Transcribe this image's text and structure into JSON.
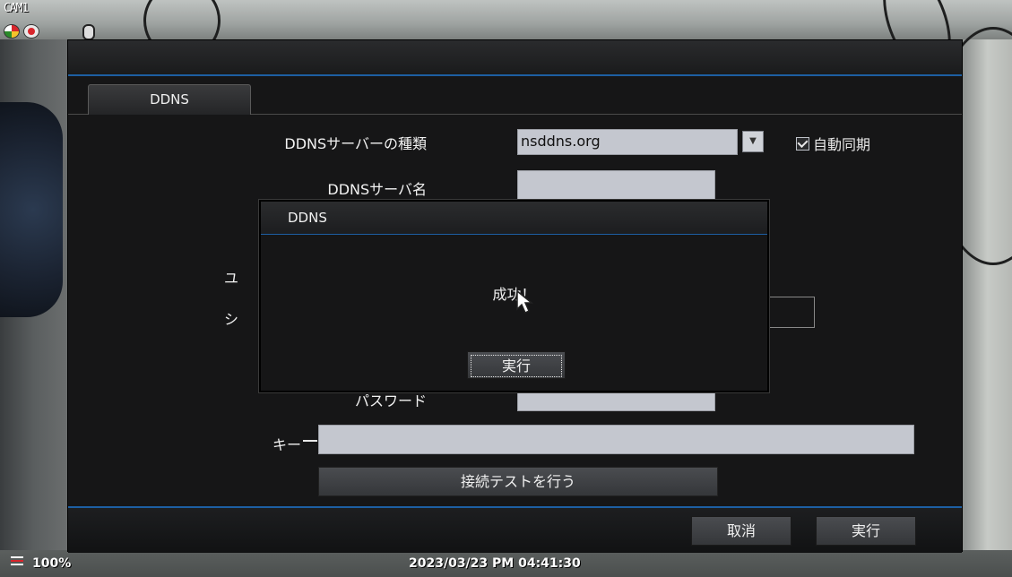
{
  "osd": {
    "camera_label": "CAM1",
    "zoom": "100%",
    "datetime": "2023/03/23 PM 04:41:30"
  },
  "tabs": [
    {
      "label": "DDNS"
    }
  ],
  "form": {
    "server_type_label": "DDNSサーバーの種類",
    "server_type_value": "nsddns.org",
    "auto_sync_label": "自動同期",
    "auto_sync_checked": true,
    "server_name_label": "DDNSサーバ名",
    "server_name_value": "",
    "user_label_partial": "ユ",
    "system_label_partial": "シ",
    "password_label": "パスワード",
    "password_value": "",
    "key_label": "キー",
    "key_value": "",
    "test_button": "接続テストを行う"
  },
  "footer": {
    "cancel": "取消",
    "apply": "実行"
  },
  "dialog": {
    "title": "DDNS",
    "message": "成功！",
    "ok": "実行"
  },
  "colors": {
    "accent": "#1d5fa3",
    "field_bg": "#c4c7cf",
    "window_bg": "#161617"
  }
}
